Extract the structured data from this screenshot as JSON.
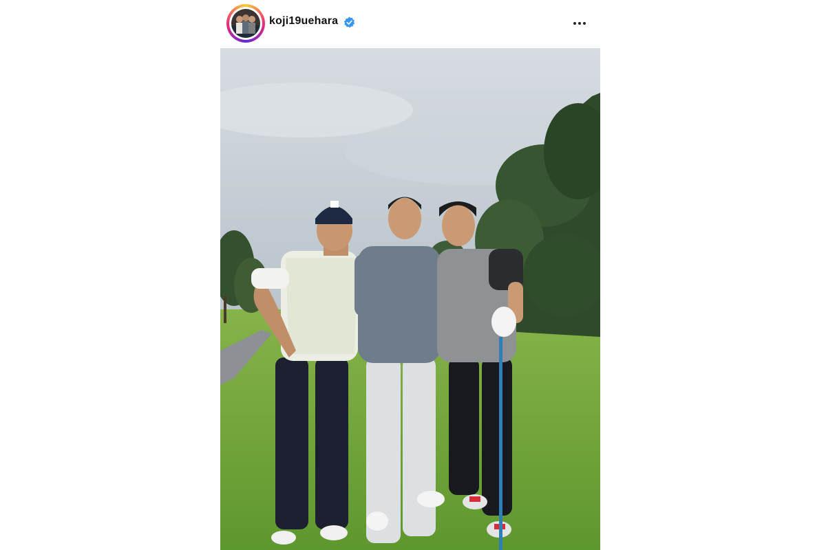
{
  "post": {
    "username": "koji19uehara",
    "verified": true,
    "avatar_icon": "profile-avatar",
    "more_icon": "more-horizontal-icon",
    "verified_icon": "verified-badge-icon",
    "verified_color": "#3897f0"
  },
  "colors": {
    "sky": "#c9d1d8",
    "grass": "#6fa53a",
    "trees": "#2f4a2c",
    "path": "#8a8d90"
  }
}
